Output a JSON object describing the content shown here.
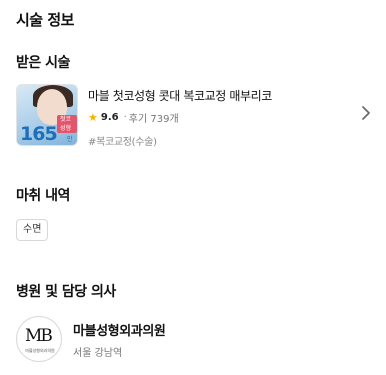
{
  "page": {
    "title": "시술 정보"
  },
  "procedure_section": {
    "title": "받은 시술",
    "item": {
      "thumbnail": {
        "tag_text": "첫코성형",
        "price": "165",
        "price_unit": "만"
      },
      "name": "마블 첫코성형 콧대 복코교정 매부리코",
      "rating": "9.6",
      "separator": "·",
      "review_text": "후기 739개",
      "tag": "#복코교정(수술)",
      "colors": {
        "star": "#f5b400"
      }
    }
  },
  "anesthesia_section": {
    "title": "마취 내역",
    "chip": "수면"
  },
  "hospital_section": {
    "title": "병원 및 담당 의사",
    "logo_text": "MB",
    "logo_subtext": "마블성형외과의원",
    "name": "마블성형외과의원",
    "location": "서울 강남역"
  }
}
